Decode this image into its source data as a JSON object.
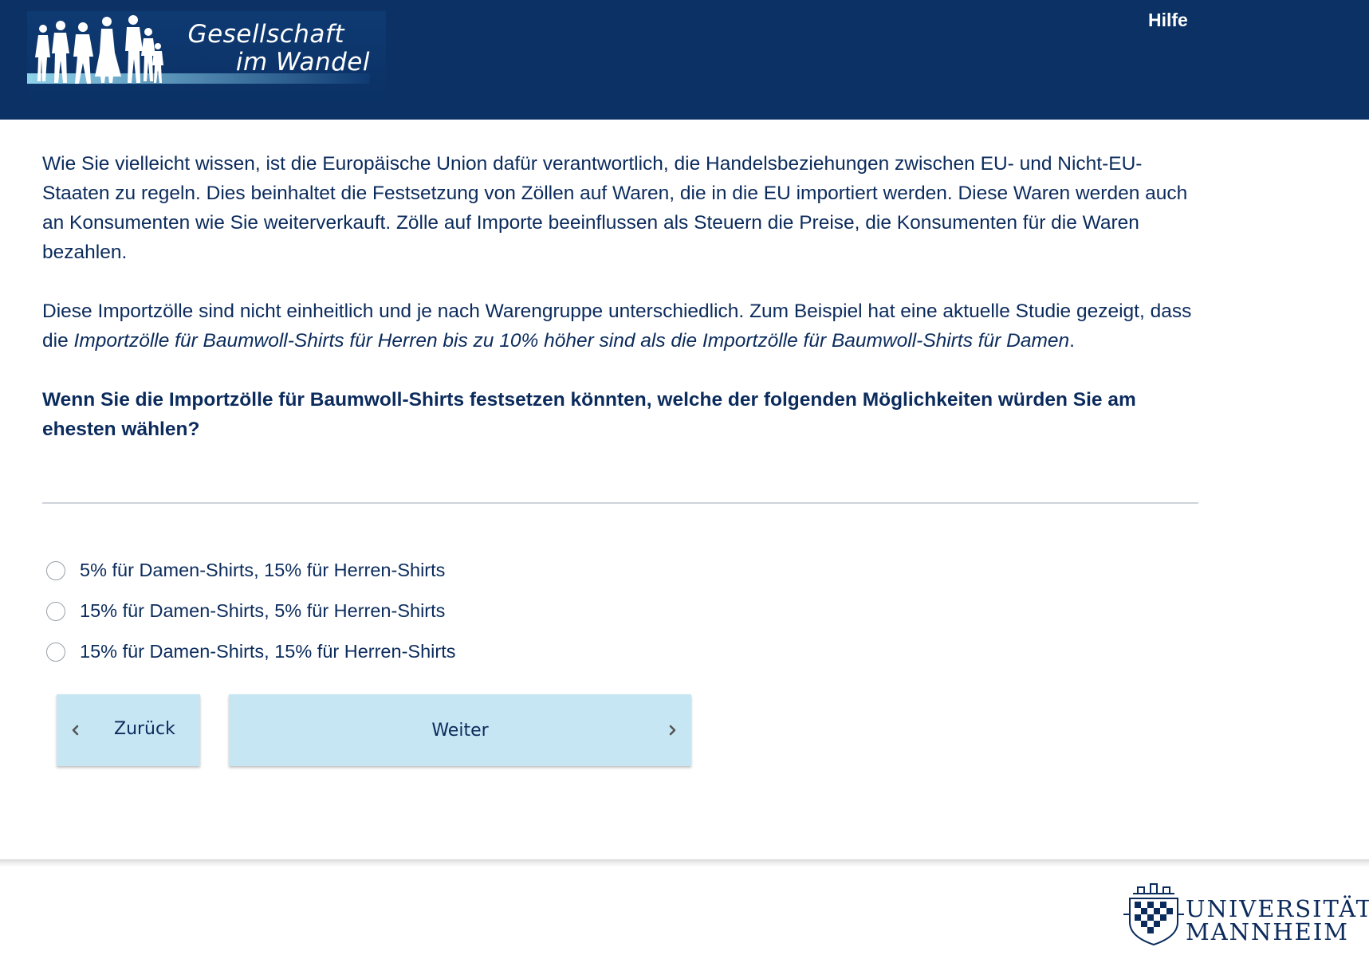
{
  "header": {
    "logo_line1": "Gesellschaft",
    "logo_line2": "im Wandel",
    "help_label": "Hilfe"
  },
  "intro": {
    "p1": "Wie Sie vielleicht wissen, ist die Europäische Union dafür verantwortlich, die Handelsbeziehungen zwischen EU- und Nicht-EU-Staaten zu regeln. Dies beinhaltet die Festsetzung von Zöllen auf Waren, die in die EU importiert werden. Diese Waren werden auch an Konsumenten wie Sie weiterverkauft. Zölle auf Importe beeinflussen als Steuern die Preise, die Konsumenten für die Waren bezahlen.",
    "p2_start": "Diese Importzölle sind nicht einheitlich und je nach Warengruppe unterschiedlich. Zum Beispiel hat eine aktuelle Studie gezeigt, dass die ",
    "p2_italic": "Importzölle für Baumwoll-Shirts für Herren bis zu 10% höher sind als die Importzölle für Baumwoll-Shirts für Damen",
    "p2_end": ".",
    "question": "Wenn Sie die Importzölle für Baumwoll-Shirts festsetzen könnten, welche der folgenden Möglichkeiten würden Sie am ehesten wählen?"
  },
  "options": [
    {
      "label": "5% für Damen-Shirts, 15% für Herren-Shirts",
      "selected": false
    },
    {
      "label": "15% für Damen-Shirts, 5% für Herren-Shirts",
      "selected": false
    },
    {
      "label": "15% für Damen-Shirts, 15% für Herren-Shirts",
      "selected": false
    }
  ],
  "nav": {
    "back_label": "Zurück",
    "next_label": "Weiter"
  },
  "footer": {
    "uni_line1": "UNIVERSITÄT",
    "uni_line2": "MANNHEIM"
  },
  "colors": {
    "header_bg": "#0b3165",
    "text": "#0b2b5c",
    "button_bg": "#c6e6f4"
  }
}
